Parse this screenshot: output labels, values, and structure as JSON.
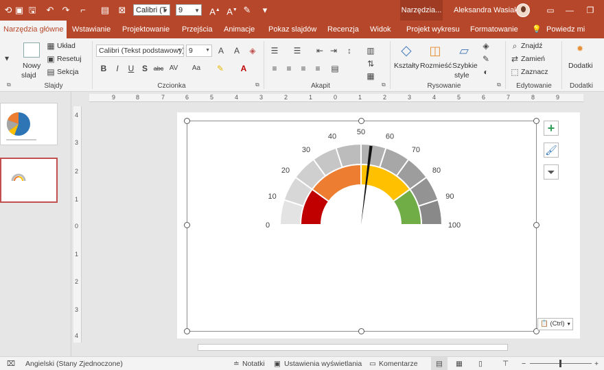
{
  "qat": {
    "font_name": "Calibri (T",
    "font_size": "9"
  },
  "titlebar": {
    "context_tab": "Narzędzia...",
    "user": "Aleksandra Wasiak"
  },
  "tabs": [
    {
      "label": "Narzędzia główne"
    },
    {
      "label": "Wstawianie"
    },
    {
      "label": "Projektowanie"
    },
    {
      "label": "Przejścia"
    },
    {
      "label": "Animacje"
    },
    {
      "label": "Pokaz slajdów"
    },
    {
      "label": "Recenzja"
    },
    {
      "label": "Widok"
    },
    {
      "label": "Projekt wykresu"
    },
    {
      "label": "Formatowanie"
    },
    {
      "label": "Powiedz mi"
    }
  ],
  "ribbon": {
    "slides": {
      "new_slide_1": "Nowy",
      "new_slide_2": "slajd",
      "layout": "Układ",
      "reset": "Resetuj",
      "section": "Sekcja",
      "label": "Slajdy"
    },
    "font": {
      "font_name": "Calibri (Tekst podstawowy)",
      "font_size": "9",
      "label": "Czcionka"
    },
    "paragraph": {
      "label": "Akapit"
    },
    "drawing": {
      "shapes": "Kształty",
      "arrange": "Rozmieść",
      "quick_styles_1": "Szybkie",
      "quick_styles_2": "style",
      "label": "Rysowanie"
    },
    "editing": {
      "find": "Znajdź",
      "replace": "Zamień",
      "select": "Zaznacz",
      "label": "Edytowanie"
    },
    "addins": {
      "addins_btn": "Dodatki",
      "label": "Dodatki"
    }
  },
  "ruler": {
    "top": [
      "9",
      "8",
      "7",
      "6",
      "5",
      "4",
      "3",
      "2",
      "1",
      "0",
      "1",
      "2",
      "3",
      "4",
      "5",
      "6",
      "7",
      "8",
      "9"
    ],
    "left": [
      "4",
      "3",
      "2",
      "1",
      "0",
      "1",
      "2",
      "3",
      "4"
    ]
  },
  "paste_options": "(Ctrl)",
  "statusbar": {
    "language": "Angielski (Stany Zjednoczone)",
    "notes": "Notatki",
    "display_settings": "Ustawienia wyświetlania",
    "comments": "Komentarze"
  },
  "chart_data": {
    "type": "gauge",
    "tick_labels": [
      "0",
      "10",
      "20",
      "30",
      "40",
      "50",
      "60",
      "70",
      "80",
      "90",
      "100"
    ],
    "range": [
      0,
      100
    ],
    "needle_value": 54,
    "outer_band_colors": [
      "#e3e3e3",
      "#d7d7d7",
      "#cfcfcf",
      "#c6c6c6",
      "#bcbcbc",
      "#b1b1b1",
      "#a7a7a7",
      "#9d9d9d",
      "#939393",
      "#898989"
    ],
    "inner_zones": [
      {
        "from": 0,
        "to": 20,
        "color": "#c00000"
      },
      {
        "from": 20,
        "to": 50,
        "color": "#ed7d31"
      },
      {
        "from": 50,
        "to": 80,
        "color": "#ffc000"
      },
      {
        "from": 80,
        "to": 100,
        "color": "#70ad47"
      }
    ]
  }
}
